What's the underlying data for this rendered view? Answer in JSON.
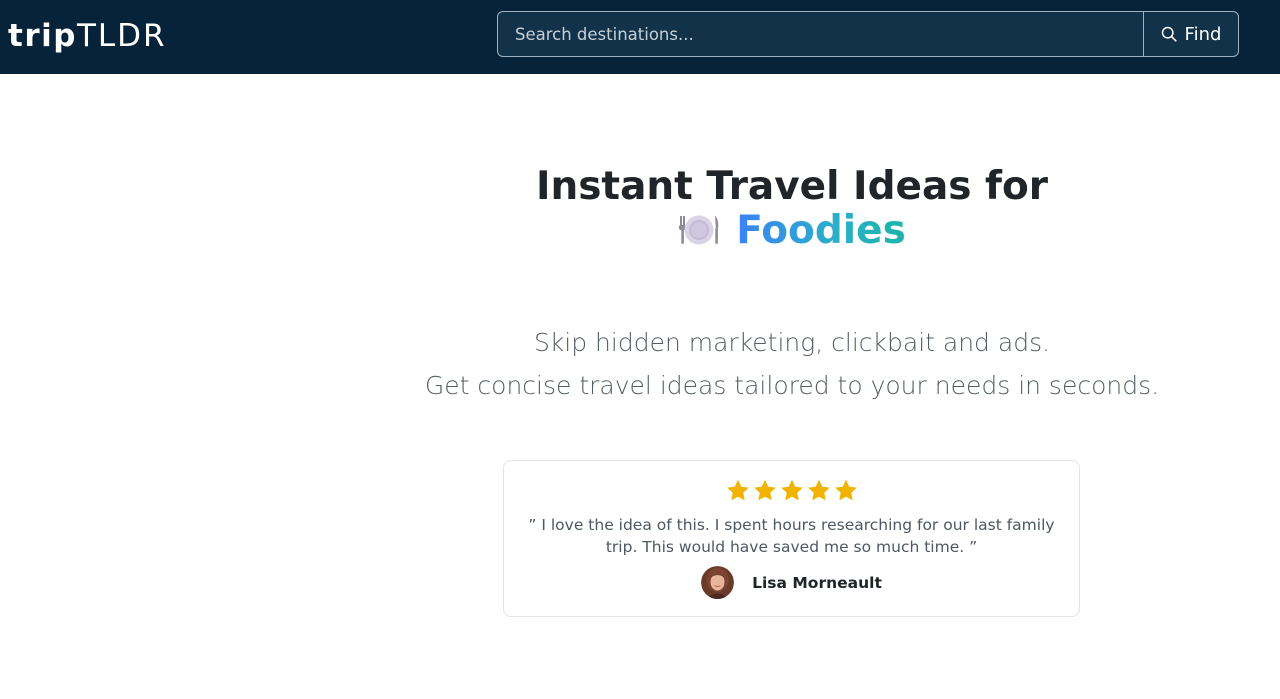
{
  "navbar": {
    "brand_bold": "trip",
    "brand_light": "TLDR",
    "search_placeholder": "Search destinations...",
    "find_label": "Find",
    "background_color": "#06233a"
  },
  "hero": {
    "title_line1": "Instant Travel Ideas for",
    "title_emoji_icon": "plate-with-cutlery-icon",
    "title_highlight": "Foodies",
    "highlight_gradient": [
      "#3b82f6",
      "#1cb5a8"
    ],
    "subtitle_line1": "Skip hidden marketing, clickbait and ads.",
    "subtitle_line2": "Get concise travel ideas tailored to your needs in seconds."
  },
  "review": {
    "rating": 5,
    "star_color": "#f0b400",
    "quote": "” I love the idea of this. I spent hours researching for our last family trip. This would have saved me so much time. ”",
    "author_name": "Lisa Morneault",
    "avatar_icon": "user-avatar"
  }
}
